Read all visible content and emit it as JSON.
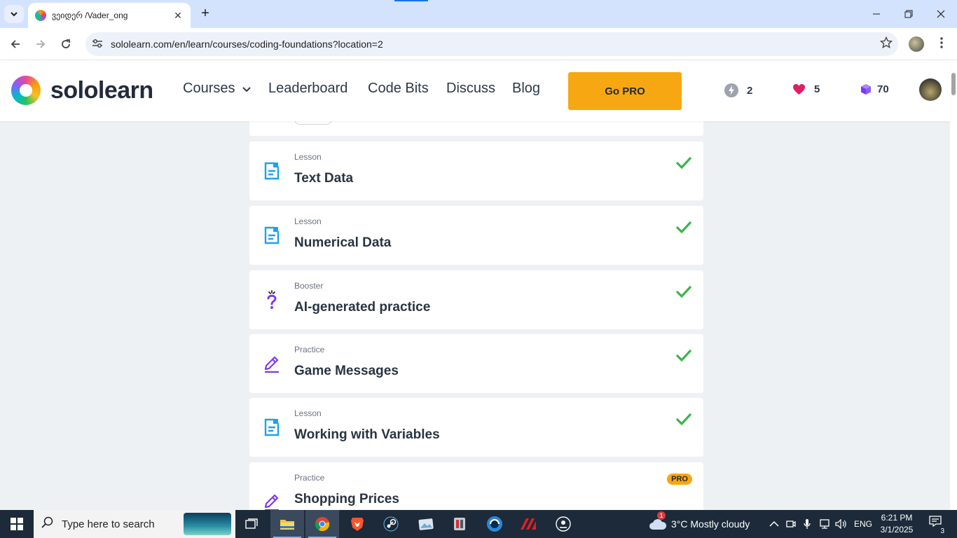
{
  "browser": {
    "tab_title": "ვეიდერ /Vader_ong",
    "tab_close": "✕",
    "new_tab": "+",
    "url": "sololearn.com/en/learn/courses/coding-foundations?location=2",
    "window_controls": {
      "minimize": "—",
      "maximize": "❐",
      "close": "✕"
    }
  },
  "site": {
    "logo_text": "sololearn",
    "nav": {
      "courses": "Courses",
      "leaderboard": "Leaderboard",
      "code_bits": "Code Bits",
      "discuss": "Discuss",
      "blog": "Blog"
    },
    "go_pro": "Go PRO",
    "stats": {
      "streak": "2",
      "hearts": "5",
      "bits": "70"
    }
  },
  "lessons": [
    {
      "type": "Lesson",
      "title": "Text Data",
      "icon": "lesson-icon",
      "status": "done"
    },
    {
      "type": "Lesson",
      "title": "Numerical Data",
      "icon": "lesson-icon",
      "status": "done"
    },
    {
      "type": "Booster",
      "title": "AI-generated practice",
      "icon": "booster-icon",
      "status": "done"
    },
    {
      "type": "Practice",
      "title": "Game Messages",
      "icon": "practice-icon",
      "status": "done"
    },
    {
      "type": "Lesson",
      "title": "Working with Variables",
      "icon": "lesson-icon",
      "status": "done"
    },
    {
      "type": "Practice",
      "title": "Shopping Prices",
      "icon": "practice-icon",
      "status": "pro",
      "badge": "PRO"
    }
  ],
  "taskbar": {
    "search_placeholder": "Type here to search",
    "weather": "3°C  Mostly cloudy",
    "weather_alert": "1",
    "language": "ENG",
    "time": "6:21 PM",
    "date": "3/1/2025",
    "notifications": "3"
  },
  "colors": {
    "accent_orange": "#f7a711",
    "check_green": "#3bb54a",
    "lesson_blue": "#1aa4e8",
    "practice_purple": "#7c3aed",
    "heart_pink": "#e11d63"
  }
}
